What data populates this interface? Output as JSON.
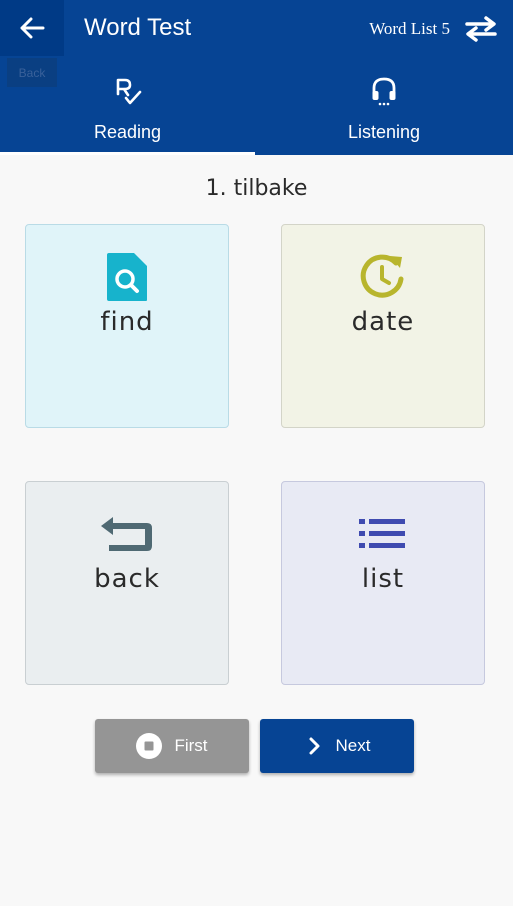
{
  "header": {
    "back_icon": "arrow-left-icon",
    "back_tooltip": "Back",
    "title": "Word Test",
    "word_list": "Word List 5",
    "swap_icon": "swap-arrows-icon",
    "background_color": "#064494"
  },
  "tabs": [
    {
      "label": "Reading",
      "icon": "reading-check-icon",
      "active": true
    },
    {
      "label": "Listening",
      "icon": "headphones-icon",
      "active": false
    }
  ],
  "question": {
    "text": "1. tilbake"
  },
  "options": [
    {
      "label": "find",
      "icon": "file-search-icon",
      "color": "#17b3cc"
    },
    {
      "label": "date",
      "icon": "clock-refresh-icon",
      "color": "#b8b52d"
    },
    {
      "label": "back",
      "icon": "return-arrow-icon",
      "color": "#4f6973"
    },
    {
      "label": "list",
      "icon": "list-icon",
      "color": "#3f4bb0"
    }
  ],
  "buttons": {
    "first_label": "First",
    "first_icon": "stop-circle-icon",
    "next_label": "Next",
    "next_icon": "chevron-right-icon"
  }
}
